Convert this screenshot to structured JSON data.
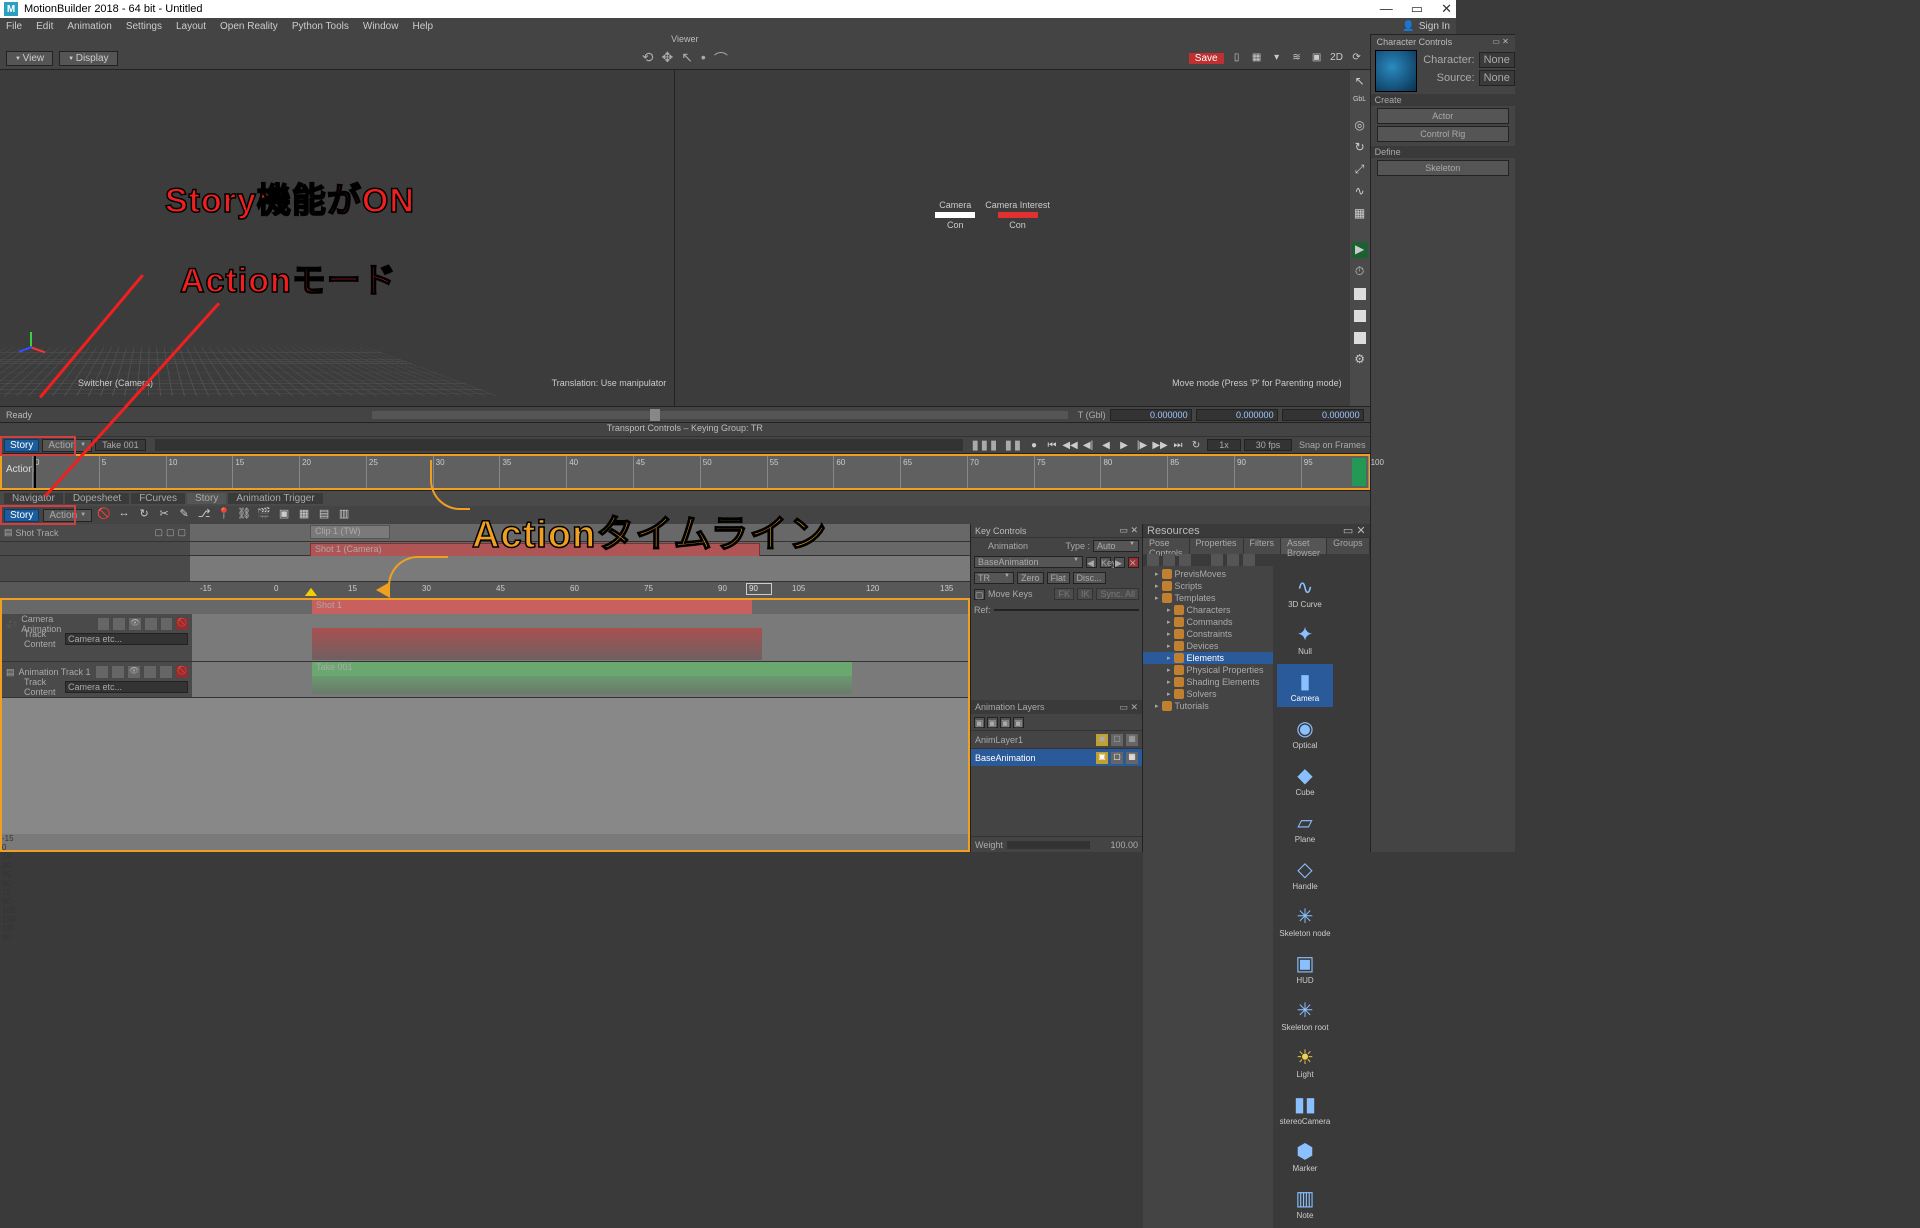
{
  "titlebar": {
    "app": "MotionBuilder 2018 - 64 bit",
    "doc": "Untitled"
  },
  "menubar": {
    "items": [
      "File",
      "Edit",
      "Animation",
      "Settings",
      "Layout",
      "Open Reality",
      "Python Tools",
      "Window",
      "Help"
    ],
    "signin": "Sign In"
  },
  "viewer": {
    "title": "Viewer"
  },
  "top_toolbar": {
    "view_btn": "View",
    "display_btn": "Display",
    "save": "Save",
    "twod": "2D"
  },
  "viewport": {
    "left_label": "Switcher (Camera)",
    "center_hint": "Translation: Use manipulator",
    "right_hint": "Move mode (Press 'P' for Parenting mode)",
    "cam_node": "Camera",
    "cam_sub": "Con",
    "int_node": "Camera Interest",
    "int_sub": "Con"
  },
  "status": {
    "ready": "Ready",
    "t_label": "T (Gbl)",
    "t_val1": "0.000000",
    "t_val2": "0.000000",
    "t_val3": "0.000000"
  },
  "transport": {
    "header": "Transport Controls  –  Keying Group: TR",
    "story": "Story",
    "action": "Action",
    "take": "Take 001",
    "rate_mult": "1x",
    "fps": "30 fps",
    "snap": "Snap on Frames",
    "ruler_label": "Action",
    "ticks": [
      0,
      5,
      10,
      15,
      20,
      25,
      30,
      35,
      40,
      45,
      50,
      55,
      60,
      65,
      70,
      75,
      80,
      85,
      90,
      95,
      100
    ]
  },
  "bottom_tabs": {
    "left": [
      "Navigator",
      "Dopesheet",
      "FCurves",
      "Story",
      "Animation Trigger"
    ],
    "active": "Story"
  },
  "story_panel": {
    "track1": "Shot Track",
    "clip_tw": "Clip 1 (TW)",
    "clip_shot": "Shot 1 (Camera)",
    "ruler": [
      -15,
      0,
      15,
      30,
      45,
      60,
      75,
      90,
      105,
      120,
      135
    ],
    "play_start": 0,
    "play_end": 90
  },
  "lower_tracks": {
    "shot_label": "Shot 1",
    "cam_track": "Camera Animation",
    "anim_track": "Animation Track 1",
    "track_content_lbl": "Track Content",
    "track_content_val": "Camera etc...",
    "take_label": "Take 001"
  },
  "key_controls": {
    "title": "Key Controls",
    "anim_lbl": "Animation",
    "type_lbl": "Type :",
    "type_val": "Auto",
    "layer_drop": "BaseAnimation",
    "tr": "TR",
    "btns": [
      "Zero",
      "Flat",
      "Disc..."
    ],
    "movekeys": "Move Keys",
    "fk": "FK",
    "ik": "IK",
    "sync": "Sync. All",
    "ref": "Ref:",
    "anim_layers_title": "Animation Layers",
    "layers": [
      "AnimLayer1",
      "BaseAnimation"
    ],
    "weight_lbl": "Weight",
    "weight_val": "100.00"
  },
  "char_controls": {
    "title": "Character Controls",
    "char_lbl": "Character:",
    "char_val": "None",
    "src_lbl": "Source:",
    "src_val": "None",
    "create": "Create",
    "actor": "Actor",
    "rig": "Control Rig",
    "define": "Define",
    "skeleton": "Skeleton"
  },
  "asset": {
    "tabs": [
      "Pose Controls",
      "Properties",
      "Filters",
      "Asset Browser",
      "Groups"
    ],
    "active": "Asset Browser",
    "tree": [
      "PrevisMoves",
      "Scripts",
      "Templates",
      "Characters",
      "Commands",
      "Constraints",
      "Devices",
      "Elements",
      "Physical Properties",
      "Shading Elements",
      "Solvers",
      "Tutorials"
    ],
    "tree_selected": "Elements",
    "items": [
      "3D Curve",
      "Null",
      "Camera",
      "Optical",
      "Cube",
      "Plane",
      "Handle",
      "Skeleton node",
      "HUD",
      "Skeleton root",
      "Light",
      "stereoCamera",
      "Marker",
      "Note"
    ],
    "item_selected": "Camera"
  },
  "annotations": {
    "line1": "Story機能がON",
    "line2": "Actionモード",
    "line3": "Actionタイムライン"
  },
  "resources_title": "Resources"
}
